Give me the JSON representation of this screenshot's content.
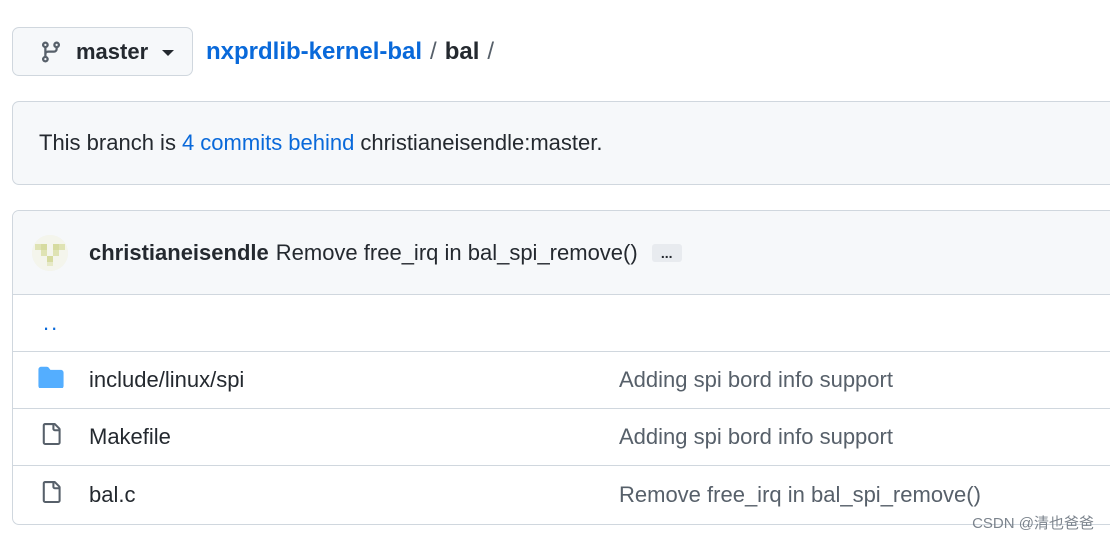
{
  "branch_selector": {
    "label": "master"
  },
  "breadcrumb": {
    "repo": "nxprdlib-kernel-bal",
    "sep1": "/",
    "current": "bal",
    "sep2": "/"
  },
  "status": {
    "prefix": "This branch is",
    "link": "4 commits behind",
    "suffix": "christianeisendle:master."
  },
  "latest_commit": {
    "author": "christianeisendle",
    "message": "Remove free_irq in bal_spi_remove()",
    "more": "..."
  },
  "files": {
    "parent": "..",
    "rows": [
      {
        "icon": "folder-icon",
        "name": "include/linux/spi",
        "message": "Adding spi bord info support"
      },
      {
        "icon": "file-icon",
        "name": "Makefile",
        "message": "Adding spi bord info support"
      },
      {
        "icon": "file-icon",
        "name": "bal.c",
        "message": "Remove free_irq in bal_spi_remove()"
      }
    ]
  },
  "watermark": "CSDN @清也爸爸",
  "colors": {
    "link": "#0969da",
    "folder": "#54aeff",
    "border": "#d0d7de",
    "header_bg": "#f6f8fa"
  }
}
